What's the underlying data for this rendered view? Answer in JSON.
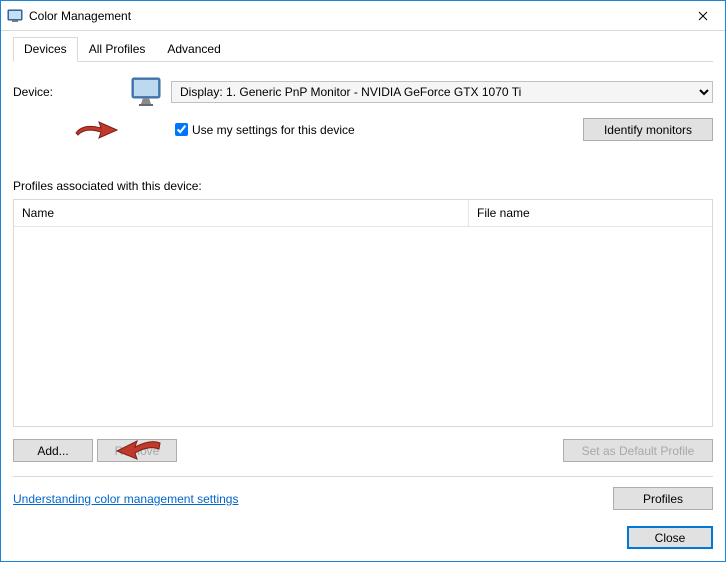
{
  "window": {
    "title": "Color Management"
  },
  "tabs": [
    {
      "label": "Devices",
      "active": true
    },
    {
      "label": "All Profiles",
      "active": false
    },
    {
      "label": "Advanced",
      "active": false
    }
  ],
  "device": {
    "label": "Device:",
    "selected": "Display: 1. Generic PnP Monitor - NVIDIA GeForce GTX 1070 Ti"
  },
  "checkbox": {
    "label": "Use my settings for this device",
    "checked": true
  },
  "buttons": {
    "identify": "Identify monitors",
    "add": "Add...",
    "remove": "Remove",
    "set_default": "Set as Default Profile",
    "profiles": "Profiles",
    "close": "Close"
  },
  "profiles": {
    "section_label": "Profiles associated with this device:",
    "columns": {
      "name": "Name",
      "file": "File name"
    },
    "rows": []
  },
  "link": {
    "text": "Understanding color management settings"
  }
}
